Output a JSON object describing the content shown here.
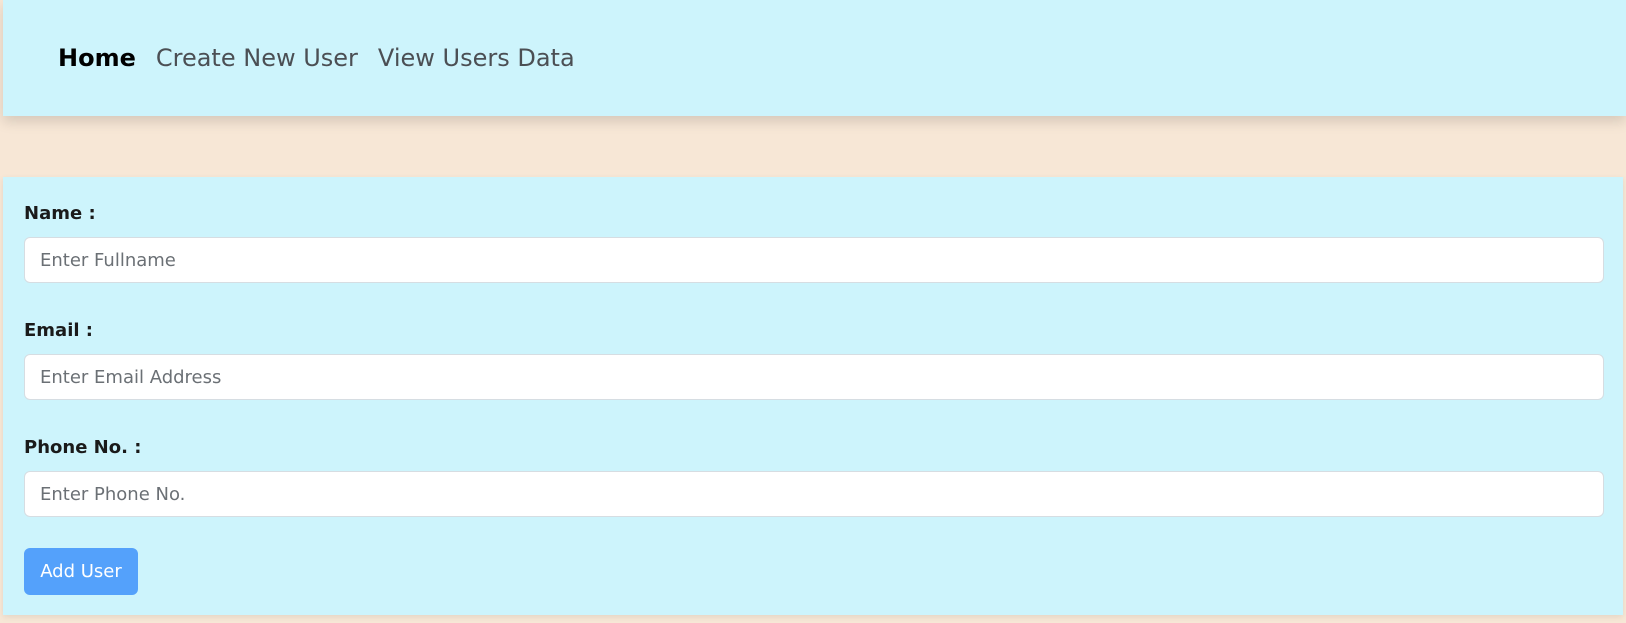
{
  "nav": {
    "items": [
      {
        "label": "Home",
        "active": true
      },
      {
        "label": "Create New User",
        "active": false
      },
      {
        "label": "View Users Data",
        "active": false
      }
    ]
  },
  "form": {
    "name": {
      "label": "Name :",
      "placeholder": "Enter Fullname",
      "value": ""
    },
    "email": {
      "label": "Email :",
      "placeholder": "Enter Email Address",
      "value": ""
    },
    "phone": {
      "label": "Phone No. :",
      "placeholder": "Enter Phone No.",
      "value": ""
    },
    "submit_label": "Add User"
  },
  "colors": {
    "page_background": "#f7e7d6",
    "panel_background": "#cdf4fc",
    "button_accent": "#54a1fb"
  }
}
